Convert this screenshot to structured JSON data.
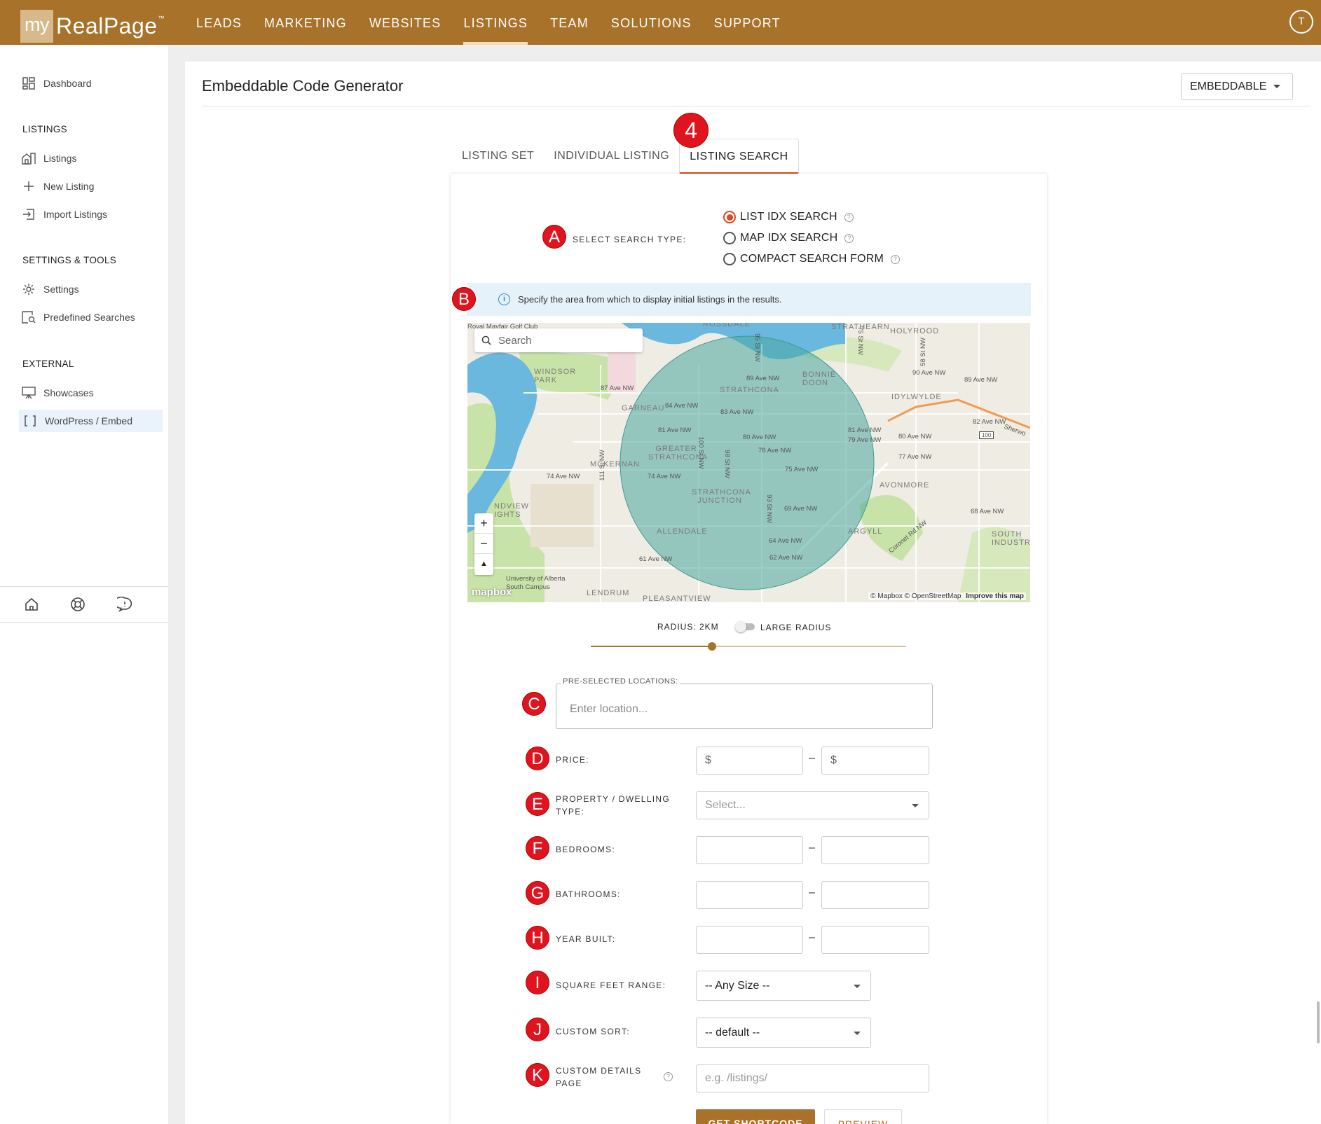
{
  "brand": {
    "logo_my": "my",
    "logo_name": "RealPage",
    "logo_tm": "™",
    "accent": "#a8722a",
    "marker_color": "#e0141e",
    "active_tab_color": "#e4461b"
  },
  "topnav": {
    "items": [
      {
        "label": "LEADS"
      },
      {
        "label": "MARKETING"
      },
      {
        "label": "WEBSITES"
      },
      {
        "label": "LISTINGS"
      },
      {
        "label": "TEAM"
      },
      {
        "label": "SOLUTIONS"
      },
      {
        "label": "SUPPORT"
      }
    ],
    "active": "LISTINGS",
    "avatar_initial": "T"
  },
  "sidebar": {
    "dashboard": "Dashboard",
    "sections": [
      {
        "title": "LISTINGS",
        "items": [
          {
            "label": "Listings",
            "icon": "building-icon"
          },
          {
            "label": "New Listing",
            "icon": "plus-icon"
          },
          {
            "label": "Import Listings",
            "icon": "import-icon"
          }
        ]
      },
      {
        "title": "SETTINGS & TOOLS",
        "items": [
          {
            "label": "Settings",
            "icon": "gear-icon"
          },
          {
            "label": "Predefined Searches",
            "icon": "search-list-icon"
          }
        ]
      },
      {
        "title": "EXTERNAL",
        "items": [
          {
            "label": "Showcases",
            "icon": "easel-icon"
          },
          {
            "label": "WordPress / Embed",
            "icon": "brackets-icon"
          }
        ]
      }
    ],
    "footer_icons": [
      "home-icon",
      "lifebuoy-icon",
      "chat-icon"
    ]
  },
  "page": {
    "title": "Embeddable Code Generator",
    "mode_button": "EMBEDDABLE"
  },
  "tabs": [
    {
      "label": "LISTING SET"
    },
    {
      "label": "INDIVIDUAL LISTING"
    },
    {
      "label": "LISTING SEARCH"
    }
  ],
  "markers": {
    "step": "4",
    "a": "A",
    "b": "B",
    "c": "C",
    "d": "D",
    "e": "E",
    "f": "F",
    "g": "G",
    "h": "H",
    "i": "I",
    "j": "J",
    "k": "K"
  },
  "search_type": {
    "label": "SELECT SEARCH TYPE:",
    "options": [
      {
        "label": "LIST IDX SEARCH",
        "selected": true
      },
      {
        "label": "MAP IDX SEARCH",
        "selected": false
      },
      {
        "label": "COMPACT SEARCH FORM",
        "selected": false
      }
    ],
    "help_glyph": "?"
  },
  "info": {
    "glyph": "i",
    "text": "Specify the area from which to display initial listings in the results."
  },
  "map": {
    "search_placeholder": "Search",
    "zoom_in": "+",
    "zoom_out": "−",
    "compass": "▲",
    "mapbox": "mapbox",
    "attribution": "© Mapbox © OpenStreetMap",
    "improve": "Improve this map",
    "labels": {
      "golf": "Royal Mayfair Golf Club",
      "rossdale": "ROSSDALE",
      "strathearn": "STRATHEARN",
      "holyrood": "HOLYROOD",
      "windsor_park": "WINDSOR PARK",
      "bonnie_doon": "BONNIE DOON",
      "ave90": "90 Ave NW",
      "ave89a": "89 Ave NW",
      "ave89b": "89 Ave NW",
      "strathcona": "STRATHCONA",
      "ave87": "87 Ave NW",
      "idylwylde": "IDYLWYLDE",
      "garneau": "GARNEAU",
      "ave84": "84 Ave NW",
      "ave83": "83 Ave NW",
      "ave82": "82 Ave NW",
      "ave81a": "81 Ave NW",
      "ave81b": "81 Ave NW",
      "ave80a": "80 Ave NW",
      "ave80b": "80 Ave NW",
      "ave79": "79 Ave NW",
      "greater_strathcona": "GREATER STRATHCONA",
      "ave78": "78 Ave NW",
      "ave77": "77 Ave NW",
      "mckernan": "MCKERNAN",
      "ave75": "75 Ave NW",
      "ave74a": "74 Ave NW",
      "ave74b": "74 Ave NW",
      "strathcona_junction": "STRATHCONA JUNCTION",
      "avonmore": "AVONMORE",
      "ave69": "69 Ave NW",
      "ave68": "68 Ave NW",
      "allendale": "ALLENDALE",
      "argyll": "ARGYLL",
      "coronet": "Coronet Rd NW",
      "ave64": "64 Ave NW",
      "ave62": "62 Ave NW",
      "ave61": "61 Ave NW",
      "uofa": "University of Alberta South Campus",
      "lendrum": "LENDRUM",
      "pleasantview": "PLEASANTVIEW",
      "south_industrial": "SOUTH INDUSTRI",
      "hwy": "100",
      "sherwood": "Sherwo",
      "riverview": "NDVIEW IGHTS",
      "st95": "95 St NW",
      "st100": "100 St NW",
      "st111": "111 St NW",
      "st75": "75 St NW",
      "st58": "58 St NW",
      "st93": "93 St NW",
      "st98": "98 St NW"
    }
  },
  "radius": {
    "label": "RADIUS: 2KM",
    "large_label": "LARGE RADIUS",
    "slider_value_pct": 38.5,
    "large_enabled": false
  },
  "form": {
    "locations": {
      "label": "PRE-SELECTED LOCATIONS:",
      "placeholder": "Enter location..."
    },
    "price": {
      "label": "PRICE:",
      "min_prefix": "$",
      "max_prefix": "$"
    },
    "property_type": {
      "label_line1": "PROPERTY / DWELLING",
      "label_line2": "TYPE:",
      "placeholder": "Select..."
    },
    "bedrooms": {
      "label": "BEDROOMS:"
    },
    "bathrooms": {
      "label": "BATHROOMS:"
    },
    "year_built": {
      "label": "YEAR BUILT:"
    },
    "sqft": {
      "label": "SQUARE FEET RANGE:",
      "value": "-- Any Size --"
    },
    "custom_sort": {
      "label": "CUSTOM SORT:",
      "value": "-- default --"
    },
    "details_page": {
      "label_line1": "CUSTOM DETAILS",
      "label_line2": "PAGE",
      "placeholder": "e.g. /listings/"
    },
    "range_dash": "–"
  },
  "actions": {
    "get_shortcode": "GET SHORTCODE",
    "preview": "PREVIEW"
  }
}
